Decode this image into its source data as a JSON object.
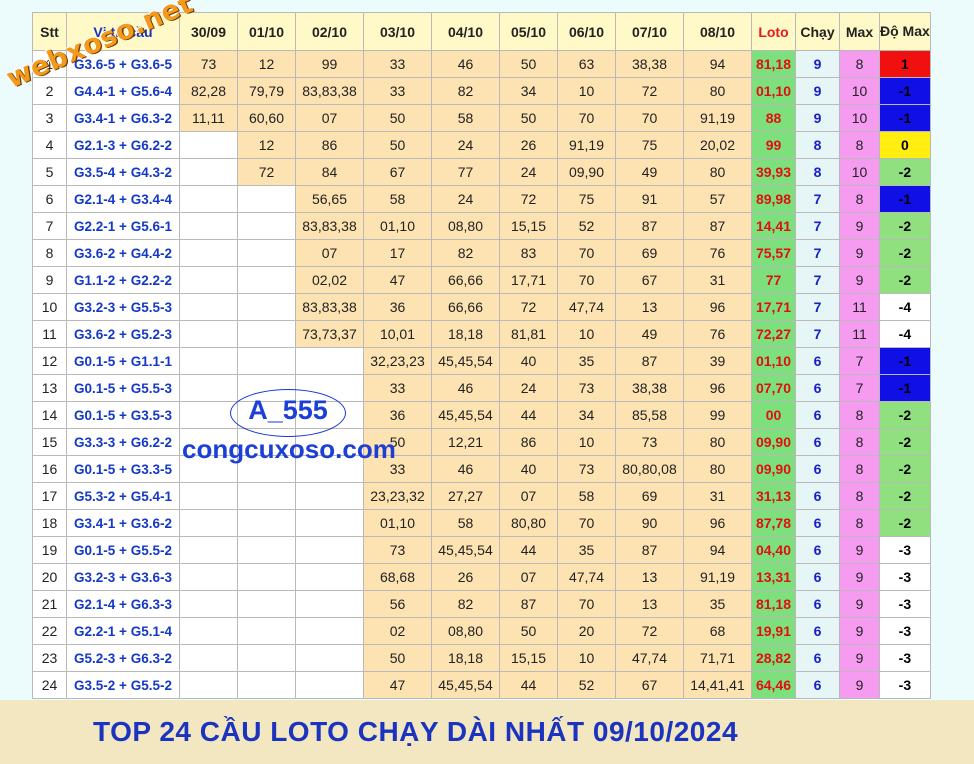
{
  "headers": [
    "Stt",
    "Vị trí cầu",
    "30/09",
    "01/10",
    "02/10",
    "03/10",
    "04/10",
    "05/10",
    "06/10",
    "07/10",
    "08/10",
    "Loto",
    "Chạy",
    "Max",
    "Độ Max"
  ],
  "rows": [
    {
      "stt": "1",
      "pos": "G3.6-5 + G3.6-5",
      "vals": [
        "73",
        "12",
        "99",
        "33",
        "46",
        "50",
        "63",
        "38,38",
        "94"
      ],
      "loto": "81,18",
      "chay": "9",
      "max": "8",
      "domax": "1",
      "dm_color": "red"
    },
    {
      "stt": "2",
      "pos": "G4.4-1 + G5.6-4",
      "vals": [
        "82,28",
        "79,79",
        "83,83,38",
        "33",
        "82",
        "34",
        "10",
        "72",
        "80"
      ],
      "loto": "01,10",
      "chay": "9",
      "max": "10",
      "domax": "-1",
      "dm_color": "blue"
    },
    {
      "stt": "3",
      "pos": "G3.4-1 + G6.3-2",
      "vals": [
        "11,11",
        "60,60",
        "07",
        "50",
        "58",
        "50",
        "70",
        "70",
        "91,19"
      ],
      "loto": "88",
      "chay": "9",
      "max": "10",
      "domax": "-1",
      "dm_color": "blue"
    },
    {
      "stt": "4",
      "pos": "G2.1-3 + G6.2-2",
      "vals": [
        "",
        "12",
        "86",
        "50",
        "24",
        "26",
        "91,19",
        "75",
        "20,02"
      ],
      "loto": "99",
      "chay": "8",
      "max": "8",
      "domax": "0",
      "dm_color": "yellow"
    },
    {
      "stt": "5",
      "pos": "G3.5-4 + G4.3-2",
      "vals": [
        "",
        "72",
        "84",
        "67",
        "77",
        "24",
        "09,90",
        "49",
        "80"
      ],
      "loto": "39,93",
      "chay": "8",
      "max": "10",
      "domax": "-2",
      "dm_color": "green"
    },
    {
      "stt": "6",
      "pos": "G2.1-4 + G3.4-4",
      "vals": [
        "",
        "",
        "56,65",
        "58",
        "24",
        "72",
        "75",
        "91",
        "57"
      ],
      "loto": "89,98",
      "chay": "7",
      "max": "8",
      "domax": "-1",
      "dm_color": "blue"
    },
    {
      "stt": "7",
      "pos": "G2.2-1 + G5.6-1",
      "vals": [
        "",
        "",
        "83,83,38",
        "01,10",
        "08,80",
        "15,15",
        "52",
        "87",
        "87"
      ],
      "loto": "14,41",
      "chay": "7",
      "max": "9",
      "domax": "-2",
      "dm_color": "green"
    },
    {
      "stt": "8",
      "pos": "G3.6-2 + G4.4-2",
      "vals": [
        "",
        "",
        "07",
        "17",
        "82",
        "83",
        "70",
        "69",
        "76"
      ],
      "loto": "75,57",
      "chay": "7",
      "max": "9",
      "domax": "-2",
      "dm_color": "green"
    },
    {
      "stt": "9",
      "pos": "G1.1-2 + G2.2-2",
      "vals": [
        "",
        "",
        "02,02",
        "47",
        "66,66",
        "17,71",
        "70",
        "67",
        "31"
      ],
      "loto": "77",
      "chay": "7",
      "max": "9",
      "domax": "-2",
      "dm_color": "green"
    },
    {
      "stt": "10",
      "pos": "G3.2-3 + G5.5-3",
      "vals": [
        "",
        "",
        "83,83,38",
        "36",
        "66,66",
        "72",
        "47,74",
        "13",
        "96"
      ],
      "loto": "17,71",
      "chay": "7",
      "max": "11",
      "domax": "-4",
      "dm_color": "white"
    },
    {
      "stt": "11",
      "pos": "G3.6-2 + G5.2-3",
      "vals": [
        "",
        "",
        "73,73,37",
        "10,01",
        "18,18",
        "81,81",
        "10",
        "49",
        "76"
      ],
      "loto": "72,27",
      "chay": "7",
      "max": "11",
      "domax": "-4",
      "dm_color": "white"
    },
    {
      "stt": "12",
      "pos": "G0.1-5 + G1.1-1",
      "vals": [
        "",
        "",
        "",
        "32,23,23",
        "45,45,54",
        "40",
        "35",
        "87",
        "39"
      ],
      "loto": "01,10",
      "chay": "6",
      "max": "7",
      "domax": "-1",
      "dm_color": "blue"
    },
    {
      "stt": "13",
      "pos": "G0.1-5 + G5.5-3",
      "vals": [
        "",
        "",
        "",
        "33",
        "46",
        "24",
        "73",
        "38,38",
        "96"
      ],
      "loto": "07,70",
      "chay": "6",
      "max": "7",
      "domax": "-1",
      "dm_color": "blue"
    },
    {
      "stt": "14",
      "pos": "G0.1-5 + G3.5-3",
      "vals": [
        "",
        "",
        "",
        "36",
        "45,45,54",
        "44",
        "34",
        "85,58",
        "99"
      ],
      "loto": "00",
      "chay": "6",
      "max": "8",
      "domax": "-2",
      "dm_color": "green"
    },
    {
      "stt": "15",
      "pos": "G3.3-3 + G6.2-2",
      "vals": [
        "",
        "",
        "",
        "50",
        "12,21",
        "86",
        "10",
        "73",
        "80"
      ],
      "loto": "09,90",
      "chay": "6",
      "max": "8",
      "domax": "-2",
      "dm_color": "green"
    },
    {
      "stt": "16",
      "pos": "G0.1-5 + G3.3-5",
      "vals": [
        "",
        "",
        "",
        "33",
        "46",
        "40",
        "73",
        "80,80,08",
        "80"
      ],
      "loto": "09,90",
      "chay": "6",
      "max": "8",
      "domax": "-2",
      "dm_color": "green"
    },
    {
      "stt": "17",
      "pos": "G5.3-2 + G5.4-1",
      "vals": [
        "",
        "",
        "",
        "23,23,32",
        "27,27",
        "07",
        "58",
        "69",
        "31"
      ],
      "loto": "31,13",
      "chay": "6",
      "max": "8",
      "domax": "-2",
      "dm_color": "green"
    },
    {
      "stt": "18",
      "pos": "G3.4-1 + G3.6-2",
      "vals": [
        "",
        "",
        "",
        "01,10",
        "58",
        "80,80",
        "70",
        "90",
        "96"
      ],
      "loto": "87,78",
      "chay": "6",
      "max": "8",
      "domax": "-2",
      "dm_color": "green"
    },
    {
      "stt": "19",
      "pos": "G0.1-5 + G5.5-2",
      "vals": [
        "",
        "",
        "",
        "73",
        "45,45,54",
        "44",
        "35",
        "87",
        "94"
      ],
      "loto": "04,40",
      "chay": "6",
      "max": "9",
      "domax": "-3",
      "dm_color": "white"
    },
    {
      "stt": "20",
      "pos": "G3.2-3 + G3.6-3",
      "vals": [
        "",
        "",
        "",
        "68,68",
        "26",
        "07",
        "47,74",
        "13",
        "91,19"
      ],
      "loto": "13,31",
      "chay": "6",
      "max": "9",
      "domax": "-3",
      "dm_color": "white"
    },
    {
      "stt": "21",
      "pos": "G2.1-4 + G6.3-3",
      "vals": [
        "",
        "",
        "",
        "56",
        "82",
        "87",
        "70",
        "13",
        "35"
      ],
      "loto": "81,18",
      "chay": "6",
      "max": "9",
      "domax": "-3",
      "dm_color": "white"
    },
    {
      "stt": "22",
      "pos": "G2.2-1 + G5.1-4",
      "vals": [
        "",
        "",
        "",
        "02",
        "08,80",
        "50",
        "20",
        "72",
        "68"
      ],
      "loto": "19,91",
      "chay": "6",
      "max": "9",
      "domax": "-3",
      "dm_color": "white"
    },
    {
      "stt": "23",
      "pos": "G5.2-3 + G6.3-2",
      "vals": [
        "",
        "",
        "",
        "50",
        "18,18",
        "15,15",
        "10",
        "47,74",
        "71,71"
      ],
      "loto": "28,82",
      "chay": "6",
      "max": "9",
      "domax": "-3",
      "dm_color": "white"
    },
    {
      "stt": "24",
      "pos": "G3.5-2 + G5.5-2",
      "vals": [
        "",
        "",
        "",
        "47",
        "45,45,54",
        "44",
        "52",
        "67",
        "14,41,41"
      ],
      "loto": "64,46",
      "chay": "6",
      "max": "9",
      "domax": "-3",
      "dm_color": "white"
    }
  ],
  "watermarks": {
    "logo": "webxoso.net",
    "code": "A_555",
    "site": "congcuxoso.com"
  },
  "footer": "TOP 24 CẦU LOTO CHẠY DÀI NHẤT 09/10/2024"
}
